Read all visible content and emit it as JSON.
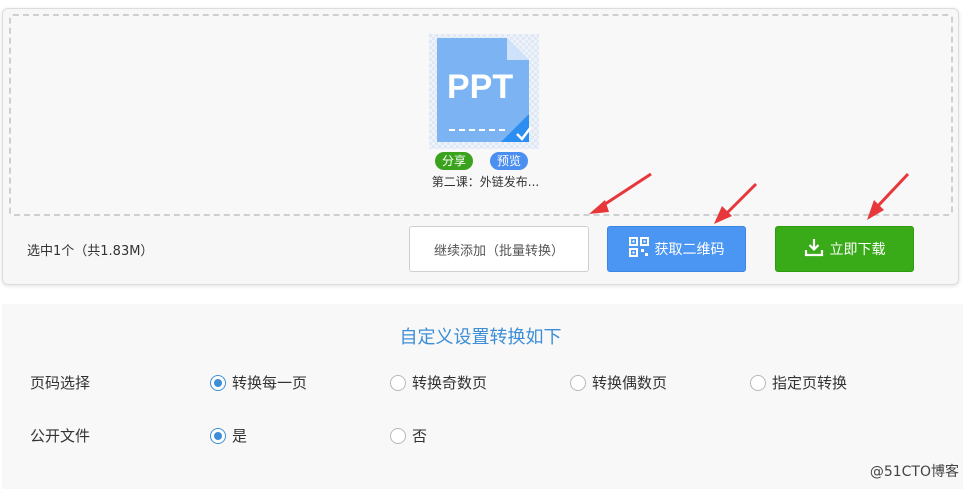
{
  "file": {
    "icon_text": "PPT",
    "share_label": "分享",
    "preview_label": "预览",
    "name": "第二课：外链发布..."
  },
  "selection": {
    "info": "选中1个（共1.83M）"
  },
  "buttons": {
    "continue_label": "继续添加（批量转换）",
    "qrcode_label": "获取二维码",
    "download_label": "立即下载"
  },
  "settings": {
    "title": "自定义设置转换如下",
    "page_select": {
      "label": "页码选择",
      "options": [
        "转换每一页",
        "转换奇数页",
        "转换偶数页",
        "指定页转换"
      ],
      "selected": "转换每一页"
    },
    "public_file": {
      "label": "公开文件",
      "options": [
        "是",
        "否"
      ],
      "selected": "是"
    }
  },
  "watermark": "@51CTO博客",
  "colors": {
    "ppt_blue": "#7bb3f3",
    "share_green": "#3aa21c",
    "preview_blue": "#4b8ff0",
    "qrcode_blue": "#4b96f2",
    "download_green": "#3aab18",
    "title_blue": "#3d8ed6",
    "arrow_red": "#e8373a"
  }
}
